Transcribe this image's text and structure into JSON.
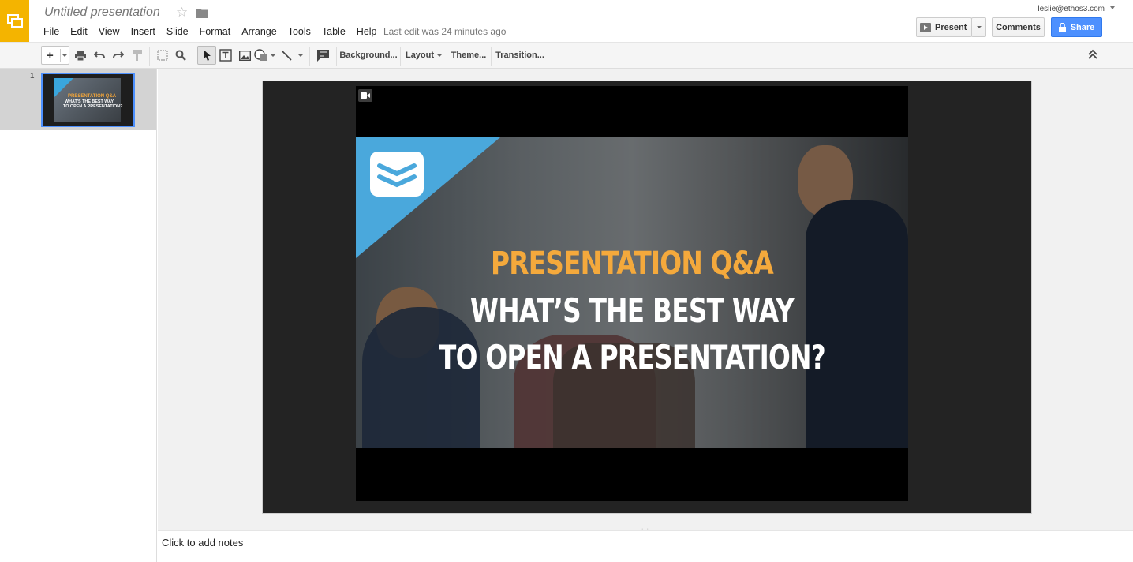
{
  "header": {
    "title": "Untitled presentation",
    "menus": [
      "File",
      "Edit",
      "View",
      "Insert",
      "Slide",
      "Format",
      "Arrange",
      "Tools",
      "Table",
      "Help"
    ],
    "last_edit": "Last edit was 24 minutes ago",
    "user_email": "leslie@ethos3.com",
    "present_label": "Present",
    "comments_label": "Comments",
    "share_label": "Share"
  },
  "toolbar": {
    "new_slide": "+",
    "background_label": "Background...",
    "layout_label": "Layout",
    "theme_label": "Theme...",
    "transition_label": "Transition..."
  },
  "filmstrip": {
    "slides": [
      {
        "number": "1",
        "thumb_line1": "PRESENTATION Q&A",
        "thumb_line2": "WHAT'S THE BEST WAY",
        "thumb_line3": "TO OPEN A PRESENTATION?"
      }
    ]
  },
  "slide": {
    "video": {
      "line1": "PRESENTATION Q&A",
      "line2": "WHAT’S THE BEST WAY",
      "line3": "TO OPEN A PRESENTATION?"
    }
  },
  "notes": {
    "placeholder": "Click to add notes"
  },
  "colors": {
    "brand_yellow": "#f4b400",
    "share_blue": "#4d90fe",
    "accent_cyan": "#4aa8dc",
    "title_orange": "#f4a93c"
  }
}
